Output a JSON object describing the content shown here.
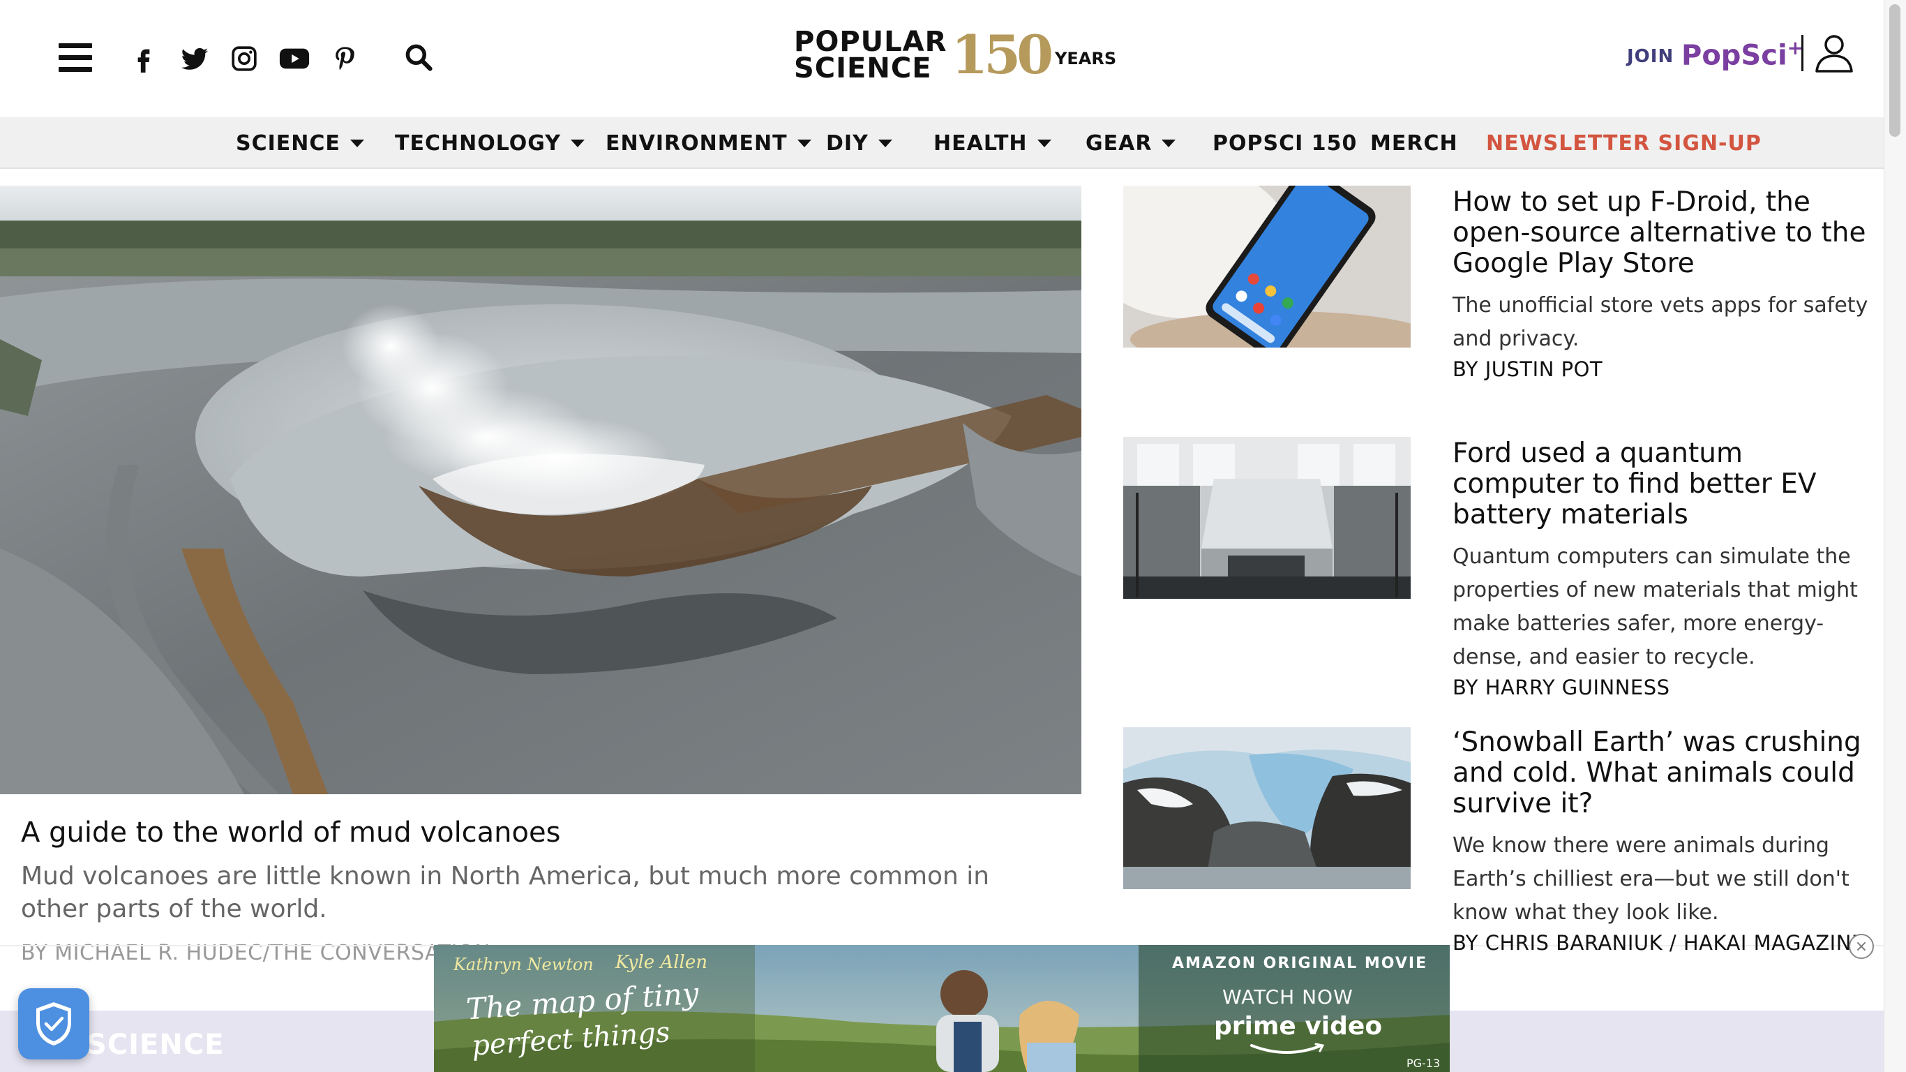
{
  "header": {
    "menu_icon": "hamburger-menu-icon",
    "social_icons": [
      "facebook-icon",
      "twitter-icon",
      "instagram-icon",
      "youtube-icon",
      "pinterest-icon"
    ],
    "search_icon": "search-icon",
    "logo_line1": "POPULAR",
    "logo_line2": "SCIENCE",
    "logo_number": "150",
    "logo_years": "YEARS",
    "join_label": "JOIN",
    "popsci_plus_label": "PopSci",
    "popsci_plus_sup": "+",
    "account_icon": "user-account-icon"
  },
  "nav": {
    "items": [
      {
        "label": "SCIENCE"
      },
      {
        "label": "TECHNOLOGY"
      },
      {
        "label": "ENVIRONMENT"
      },
      {
        "label": "DIY"
      },
      {
        "label": "HEALTH"
      },
      {
        "label": "GEAR"
      },
      {
        "label": "POPSCI 150"
      },
      {
        "label": "MERCH"
      },
      {
        "label": "NEWSLETTER SIGN-UP"
      }
    ]
  },
  "hero": {
    "title": "A guide to the world of mud volcanoes",
    "dek": "Mud volcanoes are little known in North America, but much more common in other parts of the world.",
    "byline": "BY MICHAEL R. HUDEC/THE CONVERSATION"
  },
  "side_articles": [
    {
      "title": "How to set up F-Droid, the open-source alternative to the Google Play Store",
      "dek": "The unofficial store vets apps for safety and privacy.",
      "byline": "BY JUSTIN POT"
    },
    {
      "title": "Ford used a quantum computer to find better EV battery materials",
      "dek": "Quantum computers can simulate the properties of new materials that might make batteries safer, more energy-dense, and easier to recycle.",
      "byline": "BY HARRY GUINNESS"
    },
    {
      "title": "‘Snowball Earth’ was crushing and cold. What animals could survive it?",
      "dek": "We know there were animals during Earth’s chilliest era—but we still don't know what they look like.",
      "byline": "BY CHRIS BARANIUK / HAKAI MAGAZINE"
    }
  ],
  "section": {
    "label": "SCIENCE"
  },
  "ad": {
    "cast_1": "Kathryn Newton",
    "cast_2": "Kyle Allen",
    "film_title_1": "The map of tiny",
    "film_title_2": "perfect things",
    "tagline": "AMAZON ORIGINAL MOVIE",
    "cta": "WATCH NOW",
    "brand": "prime video",
    "rating": "PG-13",
    "close_label": "×"
  },
  "colors": {
    "accent_red": "#d3543f",
    "popsci_purple": "#7a3fa0",
    "join_navy": "#3f3d7a",
    "logo_gold": "#b59a5c",
    "shield_blue": "#4d8fe0"
  }
}
